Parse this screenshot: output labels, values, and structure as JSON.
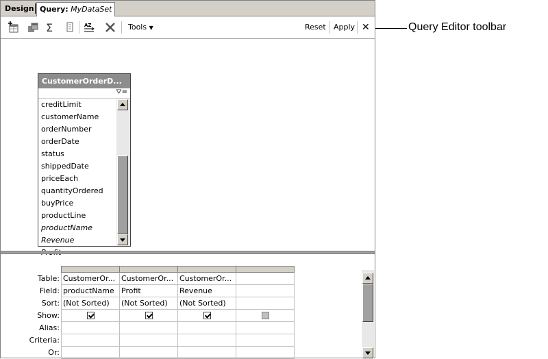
{
  "tabs": {
    "design": "Design",
    "query_prefix": "Query:",
    "query_dataset": "MyDataSet"
  },
  "toolbar": {
    "icons": [
      "add-table-icon",
      "add-related-table-icon",
      "sigma-icon",
      "properties-icon",
      "sort-icon",
      "delete-icon"
    ],
    "tools_label": "Tools",
    "reset_label": "Reset",
    "apply_label": "Apply",
    "close_glyph": "✕"
  },
  "table_window": {
    "title": "CustomerOrderD...",
    "fields": [
      {
        "name": "creditLimit",
        "italic": false
      },
      {
        "name": "customerName",
        "italic": false
      },
      {
        "name": "orderNumber",
        "italic": false
      },
      {
        "name": "orderDate",
        "italic": false
      },
      {
        "name": "status",
        "italic": false
      },
      {
        "name": "shippedDate",
        "italic": false
      },
      {
        "name": "priceEach",
        "italic": false
      },
      {
        "name": "quantityOrdered",
        "italic": false
      },
      {
        "name": "buyPrice",
        "italic": false
      },
      {
        "name": "productLine",
        "italic": false
      },
      {
        "name": "productName",
        "italic": true
      },
      {
        "name": "Revenue",
        "italic": true
      },
      {
        "name": "Profit",
        "italic": true
      }
    ]
  },
  "grid": {
    "row_labels": {
      "table": "Table:",
      "field": "Field:",
      "sort": "Sort:",
      "show": "Show:",
      "alias": "Alias:",
      "criteria": "Criteria:",
      "or": "Or:"
    },
    "columns": [
      {
        "table": "CustomerOr...",
        "field": "productName",
        "sort": "(Not Sorted)",
        "show": "checked"
      },
      {
        "table": "CustomerOr...",
        "field": "Profit",
        "sort": "(Not Sorted)",
        "show": "checked"
      },
      {
        "table": "CustomerOr...",
        "field": "Revenue",
        "sort": "(Not Sorted)",
        "show": "checked"
      },
      {
        "table": "",
        "field": "",
        "sort": "",
        "show": "disabled"
      }
    ]
  },
  "callout": {
    "label": "Query Editor toolbar"
  }
}
